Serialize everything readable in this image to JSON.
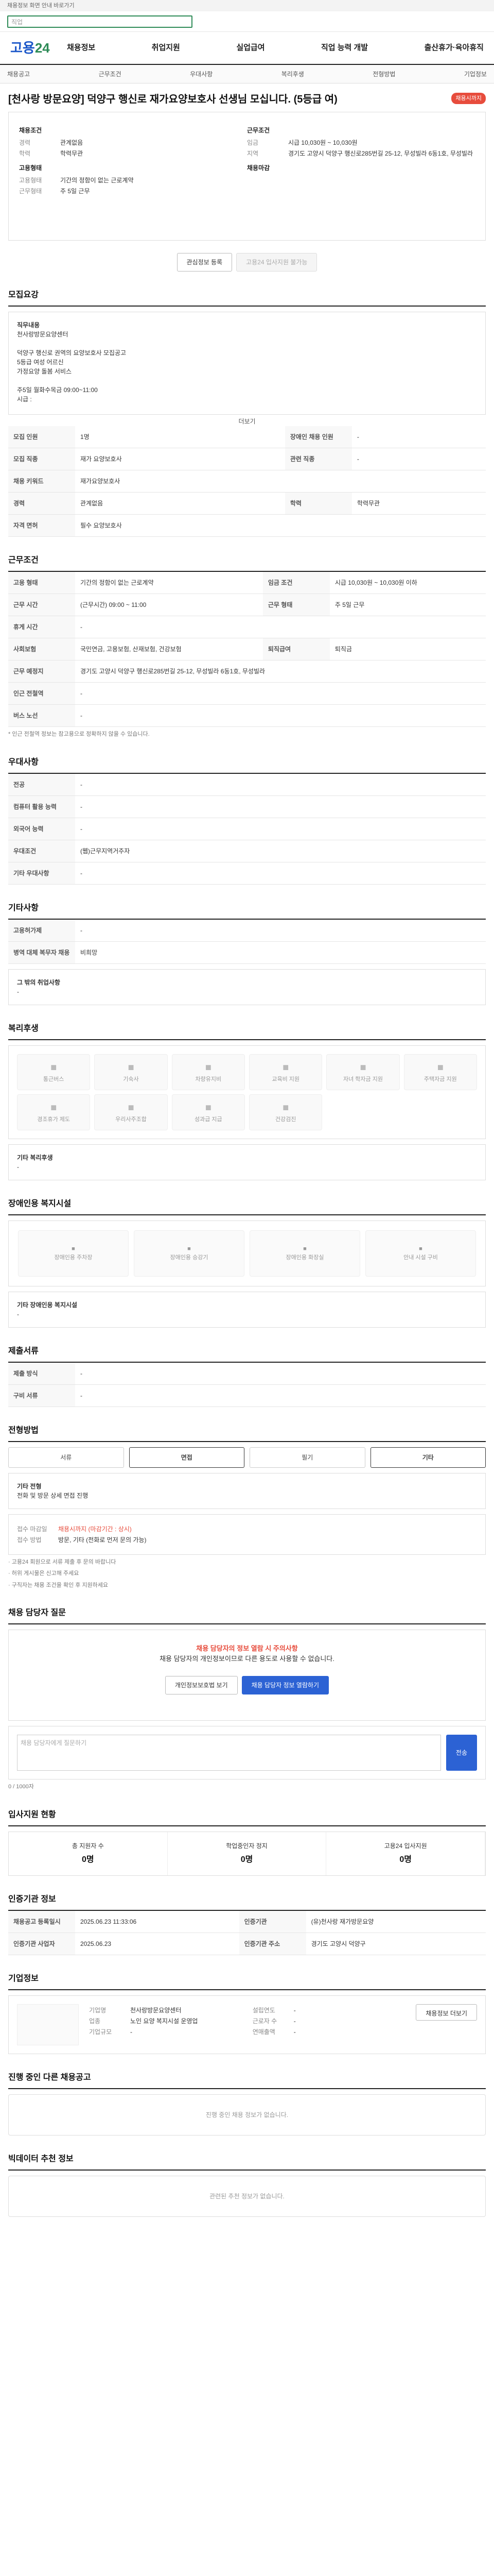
{
  "topbar": {
    "text": "채용정보 화면 안내 바로가기"
  },
  "search": {
    "placeholder": "직업"
  },
  "logo": {
    "main": "고용",
    "accent": "24"
  },
  "gnb": [
    "채용정보",
    "취업지원",
    "실업급여",
    "직업 능력 개발",
    "출산휴가·육아휴직"
  ],
  "subnav": [
    "채용공고",
    "근무조건",
    "우대사항",
    "복리후생",
    "전형방법",
    "기업정보"
  ],
  "job": {
    "title": "[천사랑 방문요양] 덕양구 행신로 재가요양보호사 선생님 모십니다. (5등급 여)",
    "badge": "채용시까지",
    "left_label": "채용조건",
    "left": [
      {
        "k": "경력",
        "v": "관계없음"
      },
      {
        "k": "학력",
        "v": "학력무관"
      }
    ],
    "left2_label": "고용형태",
    "left2": [
      {
        "k": "고용형태",
        "v": "기간의 정함이 없는 근로계약"
      },
      {
        "k": "근무형태",
        "v": "주 5일 근무"
      }
    ],
    "right_label": "근무조건",
    "right": [
      {
        "k": "임금",
        "v": "시급 10,030원 ~ 10,030원"
      },
      {
        "k": "지역",
        "v": "경기도 고양시 덕양구 행신로285번길 25-12, 무성빌라 6동1호, 무성빌라"
      }
    ],
    "right2_label": "채용마감",
    "btn1": "관심정보 등록",
    "btn2": "고용24 입사지원 불가능"
  },
  "desc": {
    "title": "모집요강",
    "label": "직무내용",
    "body": "천사랑방문요양센터\n\n덕양구 행신로 권역의 요양보호사 모집공고\n5등급 여성 어르신\n가정요양 돌봄 서비스\n\n주5일 월화수목금 09:00~11:00\n시급 :",
    "more": "더보기"
  },
  "recruit": [
    {
      "k": "모집 인원",
      "v": "1명"
    },
    {
      "k": "장애인 채용 인원",
      "v": "-"
    },
    {
      "k": "모집 직종",
      "v": "재가 요양보호사"
    },
    {
      "k": "관련 직종",
      "v": "-"
    },
    {
      "k": "채용 키워드",
      "v": "재가요양보호사"
    },
    {
      "k": "경력",
      "v": "관계없음"
    },
    {
      "k": "학력",
      "v": "학력무관"
    },
    {
      "k": "자격 면허",
      "v": "필수 요양보호사"
    }
  ],
  "cond": {
    "title": "근무조건",
    "rows": [
      {
        "k": "고용 형태",
        "v": "기간의 정함이 없는 근로계약"
      },
      {
        "k": "임금 조건",
        "v": "시급 10,030원 ~ 10,030원 이하"
      },
      {
        "k": "근무 시간",
        "v": "(근무시간) 09:00 ~ 11:00"
      },
      {
        "k": "근무 형태",
        "v": "주 5일 근무"
      },
      {
        "k": "휴게 시간",
        "v": "-"
      },
      {
        "k": "사회보험",
        "v": "국민연금, 고용보험, 산재보험, 건강보험"
      },
      {
        "k": "퇴직급여",
        "v": "퇴직금"
      },
      {
        "k": "근무 예정지",
        "v": "경기도 고양시 덕양구 행신로285번길 25-12, 무성빌라 6동1호, 무성빌라"
      },
      {
        "k": "인근 전철역",
        "v": "-"
      },
      {
        "k": "버스 노선",
        "v": "-"
      }
    ],
    "note": "* 인근 전철역 정보는 참고용으로 정확하지 않을 수 있습니다."
  },
  "pref": {
    "title": "우대사항",
    "rows": [
      {
        "k": "전공",
        "v": "-"
      },
      {
        "k": "컴퓨터 활용 능력",
        "v": "-"
      },
      {
        "k": "외국어 능력",
        "v": "-"
      },
      {
        "k": "우대조건",
        "v": "(웹)근무지역거주자"
      },
      {
        "k": "기타 우대사항",
        "v": "-"
      }
    ]
  },
  "etc": {
    "title": "기타사항",
    "rows": [
      {
        "k": "고용허가제",
        "v": "-"
      },
      {
        "k": "병역 대체 복무자 채용",
        "v": "비희망"
      }
    ],
    "label": "그 밖의 취업사항",
    "val": "-"
  },
  "welfare": {
    "title": "복리후생",
    "items": [
      "통근버스",
      "기숙사",
      "차량유지비",
      "교육비 지원",
      "자녀 학자금 지원",
      "주택자금 지원",
      "경조휴가 제도",
      "우리사주조합",
      "성과급 지급",
      "건강검진"
    ],
    "label": "기타 복리후생",
    "val": "-"
  },
  "disab": {
    "title": "장애인용 복지시설",
    "items": [
      "장애인용 주차장",
      "장애인용 승강기",
      "장애인용 화장실",
      "안내 시설 구비"
    ],
    "label": "기타 장애인용 복지시설",
    "val": "-"
  },
  "doc": {
    "title": "제출서류",
    "rows": [
      {
        "k": "제출 방식",
        "v": "-"
      },
      {
        "k": "구비 서류",
        "v": "-"
      }
    ]
  },
  "screen": {
    "title": "전형방법",
    "types": [
      "서류",
      "면접",
      "필기",
      "기타"
    ],
    "label": "기타 전형",
    "val": "전화 및 방문 상세 면접 진행"
  },
  "contact": {
    "rows": [
      {
        "k": "접수 마감일",
        "v": "채용시까지 (마감기간 : 상시)"
      },
      {
        "k": "접수 방법",
        "v": "방문, 기타 (전화로 먼저 문의 가능)"
      }
    ]
  },
  "notice": [
    "· 고용24 회원으로 서류 제출 후 문의 바랍니다",
    "· 허위 게시물은 신고해 주세요",
    "· 구직자는 채용 조건을 확인 후 지원하세요"
  ],
  "inquiry": {
    "title": "채용 담당자 질문",
    "warn": "채용 담당자의 정보 열람 시 주의사항",
    "desc": "채용 담당자의 개인정보이므로 다른 용도로 사용할 수 없습니다.",
    "btn1": "개인정보보호법 보기",
    "btn2": "채용 담당자 정보 열람하기",
    "ph": "채용 담당자에게 질문하기",
    "submit": "전송",
    "count": "0 / 1000자"
  },
  "apply": {
    "title": "입사지원 현황",
    "items": [
      {
        "k": "총 지원자 수",
        "v": "0명"
      },
      {
        "k": "학업중인자 정지",
        "v": "0명"
      },
      {
        "k": "고용24 입사지원",
        "v": "0명"
      }
    ]
  },
  "org": {
    "title": "인증기관 정보",
    "rows": [
      {
        "k": "채용공고 등록일시",
        "v": "2025.06.23 11:33:06"
      },
      {
        "k": "인증기관",
        "v": "(유)천사랑 재가방문요양"
      },
      {
        "k": "인증기관 사업자",
        "v": "2025.06.23"
      },
      {
        "k": "인증기관 주소",
        "v": "경기도 고양시 덕양구"
      }
    ]
  },
  "company": {
    "title": "기업정보",
    "rows": [
      {
        "k": "기업명",
        "v": "천사랑방문요양센터"
      },
      {
        "k": "업종",
        "v": "노인 요양 복지시설 운영업"
      },
      {
        "k": "기업규모",
        "v": "-"
      },
      {
        "k": "설립연도",
        "v": "-"
      },
      {
        "k": "근로자 수",
        "v": "-"
      },
      {
        "k": "연매출액",
        "v": "-"
      }
    ],
    "btn": "채용정보 더보기"
  },
  "similar": {
    "title": "진행 중인 다른 채용공고",
    "empty": "진행 중인 채용 정보가 없습니다."
  },
  "recommend": {
    "title": "빅데이터 추천 정보",
    "empty": "관련된 추천 정보가 없습니다."
  }
}
